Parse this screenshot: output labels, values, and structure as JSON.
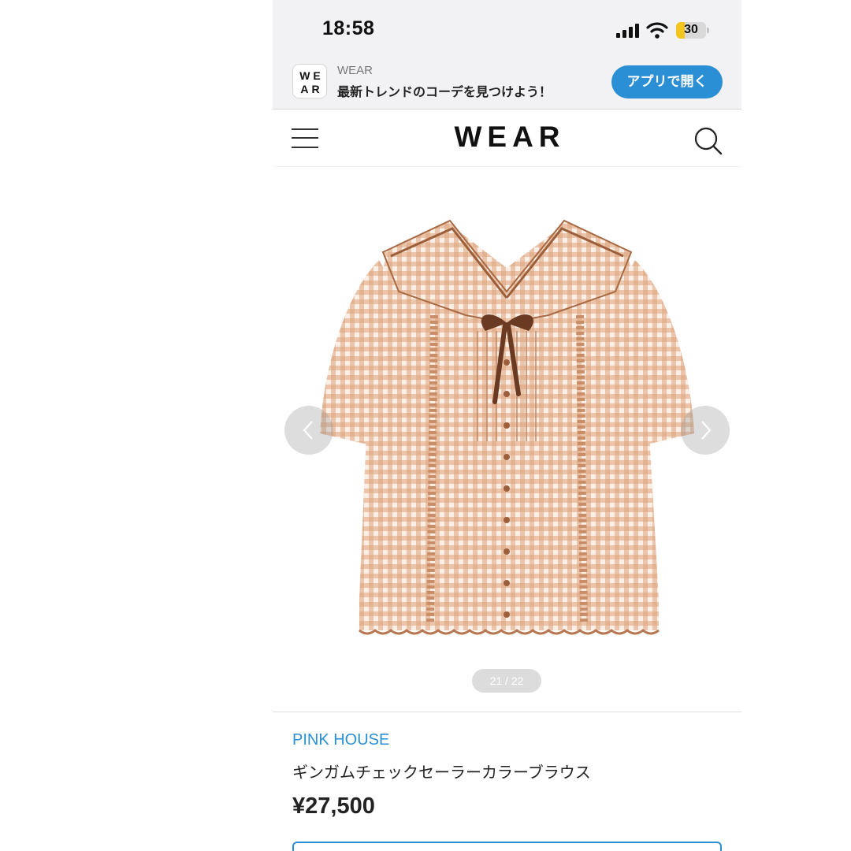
{
  "status_bar": {
    "time": "18:58",
    "battery": "30",
    "battery_level": 0.3
  },
  "app_banner": {
    "logo_line1": "WE",
    "logo_line2": "AR",
    "app_name": "WEAR",
    "tagline": "最新トレンドのコーデを見つけよう！",
    "open_button": "アプリで開く"
  },
  "header": {
    "brand": "WEAR"
  },
  "gallery": {
    "counter": "21 / 22"
  },
  "product": {
    "brand": "PINK HOUSE",
    "name": "ギンガムチェックセーラーカラーブラウス",
    "price": "¥27,500"
  },
  "colors": {
    "accent": "#2b8fd6",
    "gingham_light": "#f3dccb",
    "gingham_dark": "#d79a70",
    "ribbon": "#6b3a22"
  }
}
